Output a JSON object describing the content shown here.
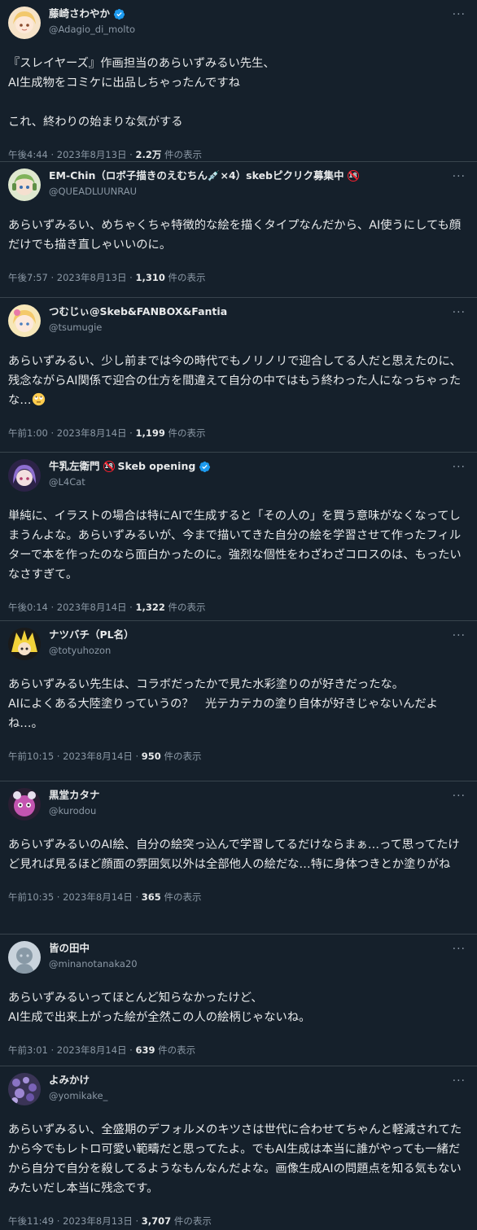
{
  "tweets": [
    {
      "name": "藤崎さわやか",
      "handle": "@Adagio_di_molto",
      "verified": true,
      "body": "『スレイヤーズ』作画担当のあらいずみるい先生、\nAI生成物をコミケに出品しちゃったんですね\n\nこれ、終わりの始まりな気がする",
      "time": "午後4:44 · 2023年8月13日",
      "views": "2.2万",
      "views_suffix": " 件の表示",
      "avatar_color": "#f3d2b3",
      "avatar_icon": "anime-girl-blonde-avatar"
    },
    {
      "name": "EM-Chin（ロボ子描きのえむちん💉×4）skebピクリク募集中",
      "handle": "@QUEADLUUNRAU",
      "verified": false,
      "r18": true,
      "body": "あらいずみるい、めちゃくちゃ特徴的な絵を描くタイプなんだから、AI使うにしても顔だけでも描き直しゃいいのに。",
      "time": "午後7:57 · 2023年8月13日",
      "views": "1,310",
      "views_suffix": " 件の表示",
      "avatar_color": "#8fbf6a",
      "avatar_icon": "robot-girl-avatar"
    },
    {
      "name": "つむじぃ@Skeb&FANBOX&Fantia",
      "handle": "@tsumugie",
      "verified": false,
      "body": "あらいずみるい、少し前までは今の時代でもノリノリで迎合してる人だと思えたのに、残念ながらAI関係で迎合の仕方を間違えて自分の中ではもう終わった人になっちゃったな…",
      "emoji": "rolling-eyes-emoji",
      "time": "午前1:00 · 2023年8月14日",
      "views": "1,199",
      "views_suffix": " 件の表示",
      "avatar_color": "#f6d58a",
      "avatar_icon": "anime-girl-pink-hair-avatar"
    },
    {
      "name": "牛乳左衛門",
      "name_suffix": "Skeb opening",
      "handle": "@L4Cat",
      "verified": true,
      "r18": true,
      "body": "単純に、イラストの場合は特にAIで生成すると「その人の」を買う意味がなくなってしまうんよな。あらいずみるいが、今まで描いてきた自分の絵を学習させて作ったフィルターで本を作ったのなら面白かったのに。強烈な個性をわざわざコロスのは、もったいなさすぎて。",
      "time": "午後0:14 · 2023年8月14日",
      "views": "1,322",
      "views_suffix": " 件の表示",
      "avatar_color": "#9a7fd1",
      "avatar_icon": "purple-hair-girl-avatar"
    },
    {
      "name": "ナツバチ（PL名）",
      "handle": "@totyuhozon",
      "verified": false,
      "body": "あらいずみるい先生は、コラボだったかで見た水彩塗りのが好きだったな。\nAIによくある大陸塗りっていうの？　光テカテカの塗り自体が好きじゃないんだよね…。",
      "time": "午前10:15 · 2023年8月14日",
      "views": "950",
      "views_suffix": " 件の表示",
      "avatar_color": "#f2d23a",
      "avatar_icon": "yellow-hair-character-avatar"
    },
    {
      "name": "黒堂カタナ",
      "handle": "@kurodou",
      "verified": false,
      "body": "あらいずみるいのAI絵、自分の絵突っ込んで学習してるだけならまぁ…って思ってたけど見れば見るほど顔面の雰囲気以外は全部他人の絵だな…特に身体つきとか塗りがね",
      "time": "午前10:35 · 2023年8月14日",
      "views": "365",
      "views_suffix": " 件の表示",
      "avatar_color": "#c455b0",
      "avatar_icon": "purple-creature-avatar"
    },
    {
      "name": "皆の田中",
      "handle": "@minanotanaka20",
      "verified": false,
      "body": "あらいずみるいってほとんど知らなかったけど、\nAI生成で出来上がった絵が全然この人の絵柄じゃないね。",
      "time": "午前3:01 · 2023年8月14日",
      "views": "639",
      "views_suffix": " 件の表示",
      "avatar_color": "#c9d3dc",
      "avatar_icon": "default-user-avatar"
    },
    {
      "name": "よみかけ",
      "handle": "@yomikake_",
      "verified": false,
      "body": "あらいずみるい、全盛期のデフォルメのキツさは世代に合わせてちゃんと軽減されてたから今でもレトロ可愛い範疇だと思ってたよ。でもAI生成は本当に誰がやっても一緒だから自分で自分を殺してるようなもんなんだよな。画像生成AIの問題点を知る気もないみたいだし本当に残念です。",
      "time": "午後11:49 · 2023年8月13日",
      "views": "3,707",
      "views_suffix": " 件の表示",
      "avatar_color": "#6e5aa8",
      "avatar_icon": "lavender-flowers-avatar"
    }
  ],
  "more_label": "···"
}
